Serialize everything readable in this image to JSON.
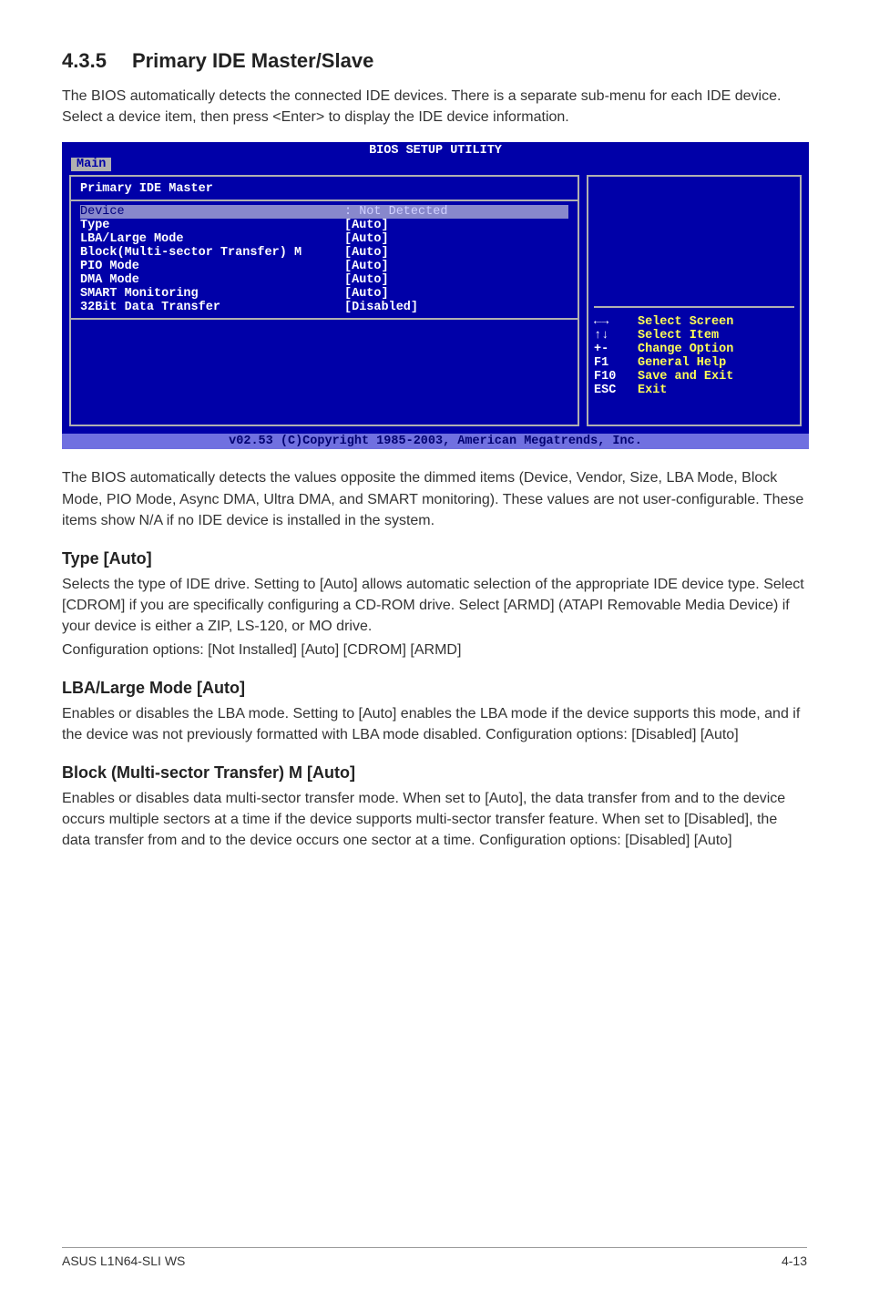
{
  "section": {
    "number": "4.3.5",
    "title": "Primary IDE Master/Slave",
    "intro": "The BIOS automatically detects the connected IDE devices. There is a separate sub-menu for each IDE device. Select a device item, then press <Enter> to display the IDE device information."
  },
  "bios": {
    "utility_title": "BIOS SETUP UTILITY",
    "tab": "Main",
    "panel_title": "Primary IDE Master",
    "device_row": {
      "label": "Device",
      "value": ": Not Detected"
    },
    "rows": [
      {
        "label": "Type",
        "value": "[Auto]"
      },
      {
        "label": "LBA/Large Mode",
        "value": "[Auto]"
      },
      {
        "label": "Block(Multi-sector Transfer) M",
        "value": "[Auto]"
      },
      {
        "label": "PIO Mode",
        "value": "[Auto]"
      },
      {
        "label": "DMA Mode",
        "value": "[Auto]"
      },
      {
        "label": "SMART Monitoring",
        "value": "[Auto]"
      },
      {
        "label": "32Bit Data Transfer",
        "value": "[Disabled]"
      }
    ],
    "nav": [
      {
        "key": "←→",
        "action": "Select Screen"
      },
      {
        "key": "↑↓",
        "action": "Select Item"
      },
      {
        "key": "+-",
        "action": "Change Option"
      },
      {
        "key": "F1",
        "action": "General Help"
      },
      {
        "key": "F10",
        "action": "Save and Exit"
      },
      {
        "key": "ESC",
        "action": "Exit"
      }
    ],
    "footer": "v02.53 (C)Copyright 1985-2003, American Megatrends, Inc."
  },
  "after_bios": "The BIOS automatically detects the values opposite the dimmed items (Device, Vendor, Size, LBA Mode, Block Mode, PIO Mode, Async DMA, Ultra DMA, and SMART monitoring). These values are not user-configurable. These items show N/A if no IDE device is installed in the system.",
  "type_section": {
    "heading": "Type [Auto]",
    "p1": "Selects the type of IDE drive. Setting to [Auto] allows automatic selection of the appropriate IDE device type. Select [CDROM] if you are specifically configuring a CD-ROM drive. Select [ARMD] (ATAPI Removable Media Device) if your device is either a ZIP, LS-120, or MO drive.",
    "p2": "Configuration options: [Not Installed] [Auto] [CDROM] [ARMD]"
  },
  "lba_section": {
    "heading": "LBA/Large Mode [Auto]",
    "p": "Enables or disables the LBA mode. Setting to [Auto] enables the LBA mode if the device supports this mode, and if the device was not previously formatted with LBA mode disabled. Configuration options: [Disabled] [Auto]"
  },
  "block_section": {
    "heading": "Block (Multi-sector Transfer) M [Auto]",
    "p": "Enables or disables data multi-sector transfer mode. When set to [Auto], the data transfer from and to the device occurs multiple sectors at a time if the device supports multi-sector transfer feature. When set to [Disabled], the data transfer from and to the device occurs one sector at a time. Configuration options: [Disabled] [Auto]"
  },
  "footer": {
    "left": "ASUS L1N64-SLI WS",
    "right": "4-13"
  }
}
